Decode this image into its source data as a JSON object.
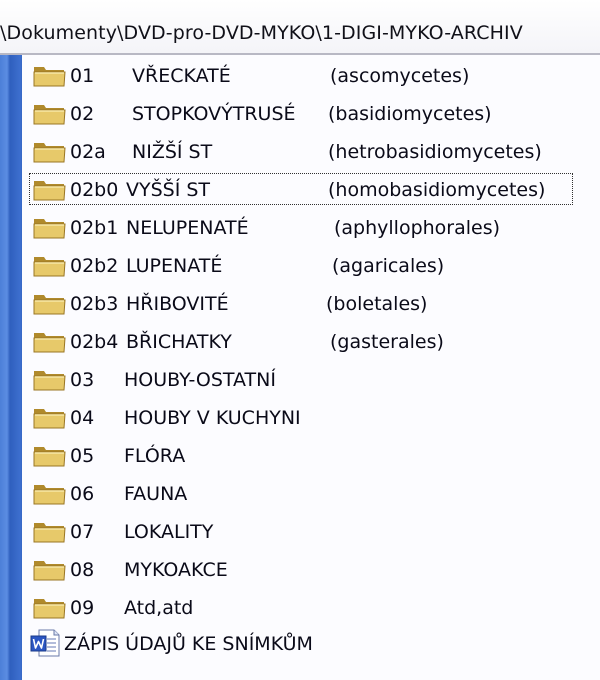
{
  "address_bar": {
    "path": "\\Dokumenty\\DVD-pro-DVD-MYKO\\1-DIGI-MYKO-ARCHIV"
  },
  "icons": {
    "folder": "folder-icon",
    "document": "word-document-icon"
  },
  "colors": {
    "rail_blue": "#3d6fce",
    "folder_yellow": "#e7c96a",
    "folder_dark": "#b08a2c",
    "word_blue": "#2b56c2"
  },
  "files": [
    {
      "code": "01",
      "name": "VŘECKATÉ",
      "latin": "(ascomycetes)"
    },
    {
      "code": "02",
      "name": "STOPKOVÝTRUSÉ",
      "latin": "(basidiomycetes)"
    },
    {
      "code": "02a",
      "name": "NIŽŠÍ ST",
      "latin": "(hetrobasidiomycetes)"
    },
    {
      "code": "02b0",
      "name": "VYŠŠÍ ST",
      "latin": "(homobasidiomycetes)"
    },
    {
      "code": "02b1",
      "name": "NELUPENATÉ",
      "latin": "(aphyllophorales)"
    },
    {
      "code": "02b2",
      "name": "LUPENATÉ",
      "latin": "(agaricales)"
    },
    {
      "code": "02b3",
      "name": "HŘIBOVITÉ",
      "latin": "(boletales)"
    },
    {
      "code": "02b4",
      "name": "BŘICHATKY",
      "latin": "(gasterales)"
    },
    {
      "code": "03",
      "name": "HOUBY-OSTATNÍ",
      "latin": ""
    },
    {
      "code": "04",
      "name": "HOUBY V KUCHYNI",
      "latin": ""
    },
    {
      "code": "05",
      "name": "FLÓRA",
      "latin": ""
    },
    {
      "code": "06",
      "name": "FAUNA",
      "latin": ""
    },
    {
      "code": "07",
      "name": "LOKALITY",
      "latin": ""
    },
    {
      "code": "08",
      "name": "MYKOAKCE",
      "latin": ""
    },
    {
      "code": "09",
      "name": "Atd,atd",
      "latin": ""
    }
  ],
  "document": {
    "name": "ZÁPIS ÚDAJŮ KE SNÍMKŮM"
  },
  "selected_index": 3
}
